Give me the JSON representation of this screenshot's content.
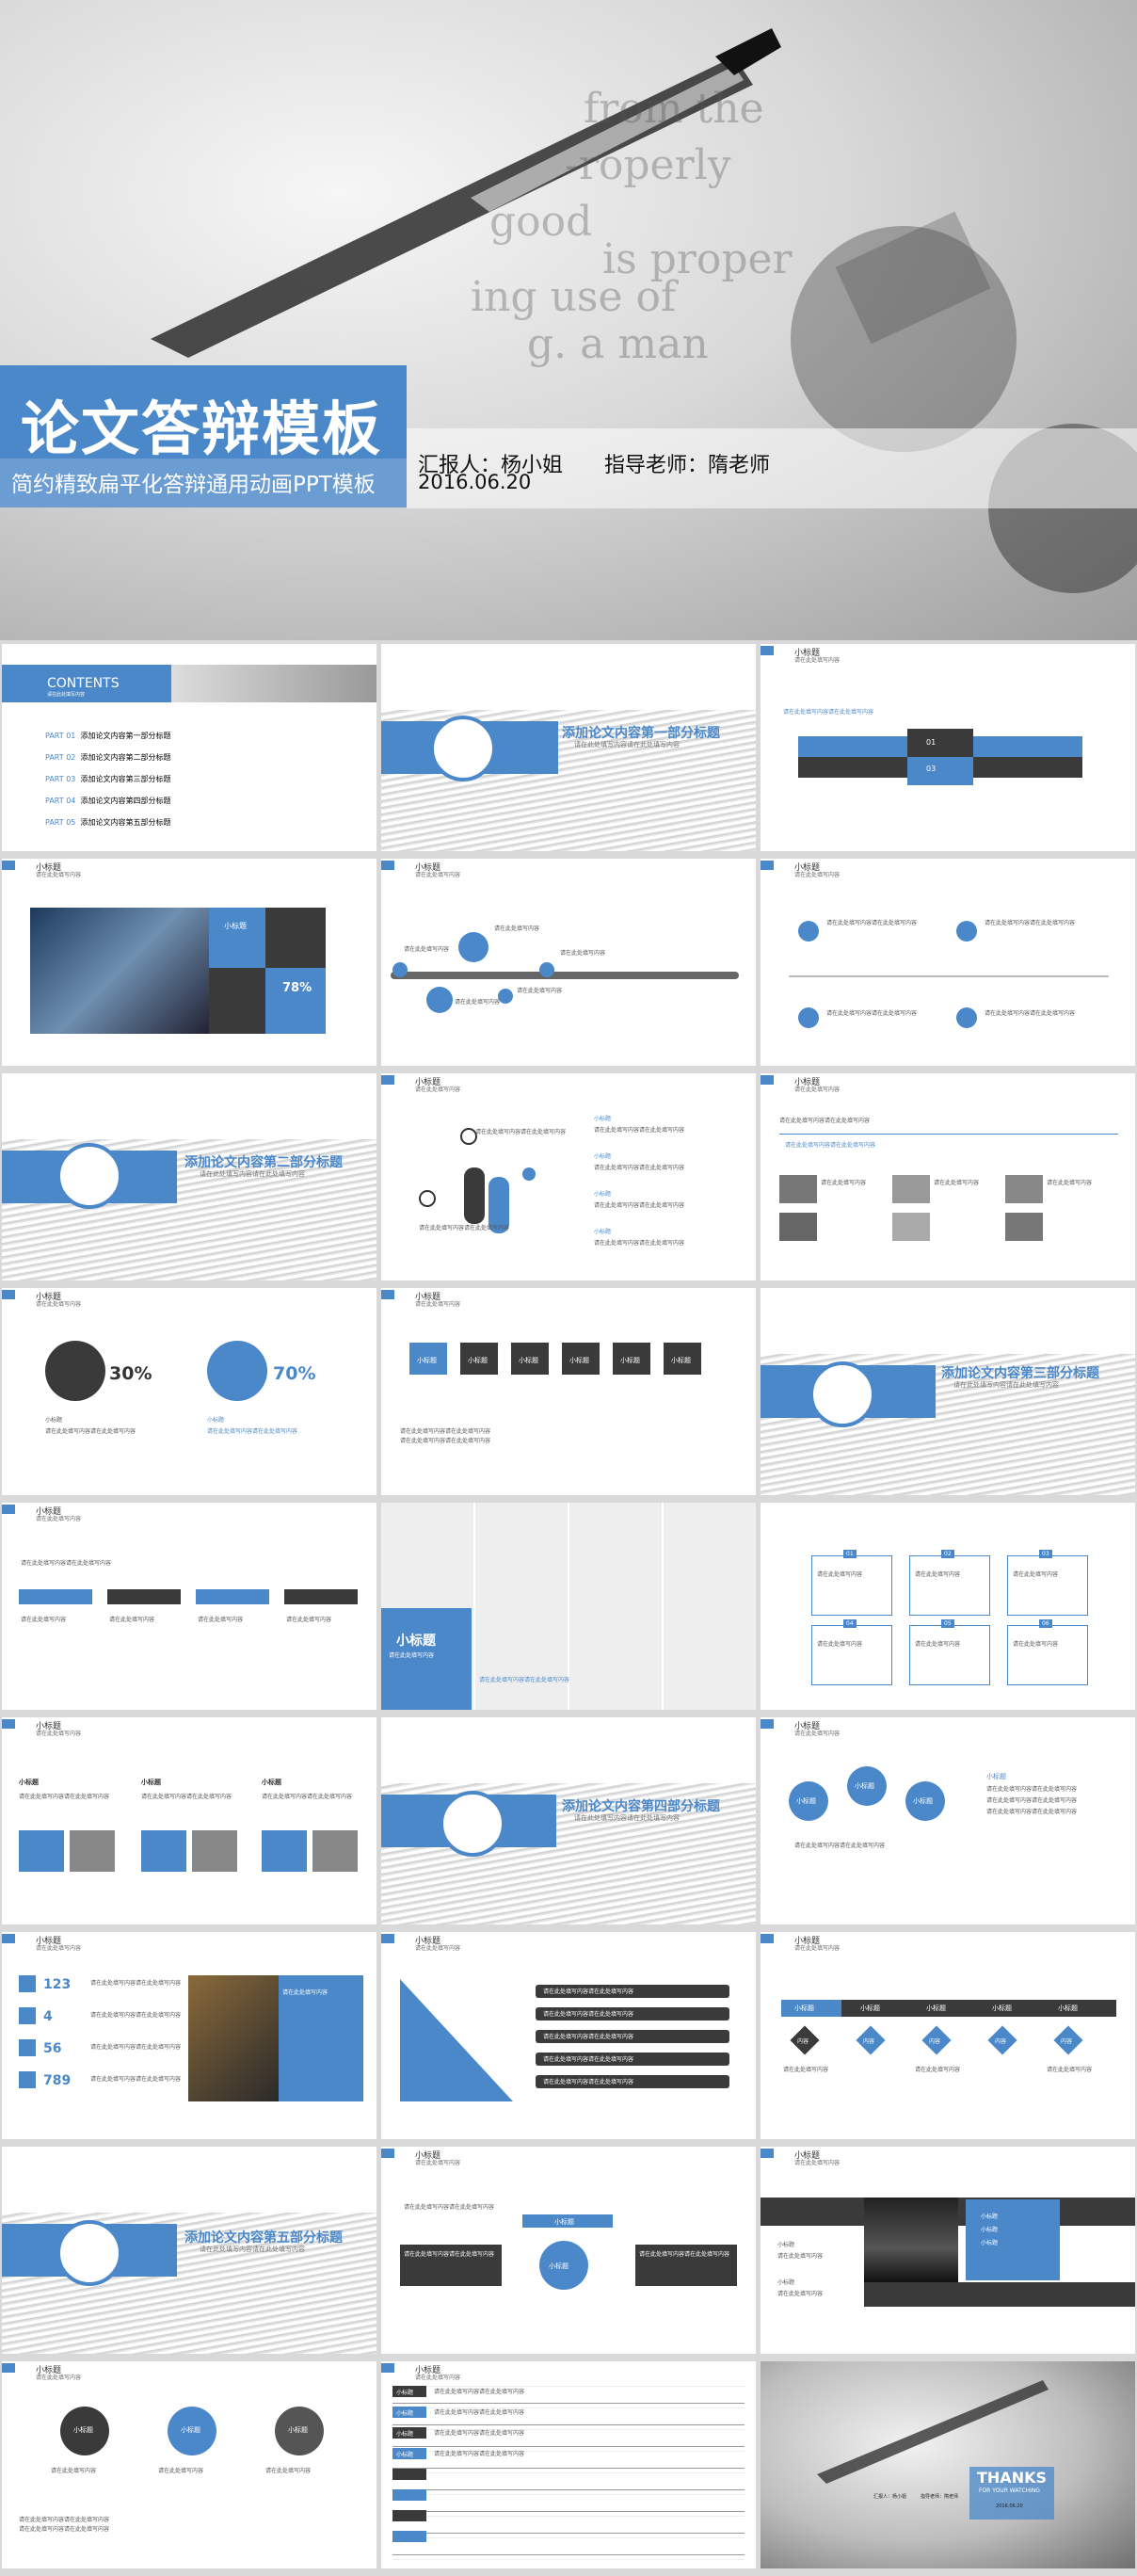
{
  "cover": {
    "title": "论文答辩模板",
    "subtitle": "简约精致扁平化答辩通用动画PPT模板",
    "reporter": "汇报人：杨小姐",
    "advisor": "指导老师：隋老师",
    "date": "2016.06.20"
  },
  "contents": {
    "heading": "CONTENTS",
    "items": [
      {
        "num": "PART 01",
        "label": "添加论文内容第一部分标题"
      },
      {
        "num": "PART 02",
        "label": "添加论文内容第二部分标题"
      },
      {
        "num": "PART 03",
        "label": "添加论文内容第三部分标题"
      },
      {
        "num": "PART 04",
        "label": "添加论文内容第四部分标题"
      },
      {
        "num": "PART 05",
        "label": "添加论文内容第五部分标题"
      }
    ]
  },
  "common": {
    "small_title": "小标题",
    "sample": "请在此处填写内容请在此处填写内容",
    "sample_short": "请在此处填写内容"
  },
  "sections": {
    "s1": "添加论文内容第一部分标题",
    "s2": "添加论文内容第二部分标题",
    "s3": "添加论文内容第三部分标题",
    "s4": "添加论文内容第四部分标题",
    "s5": "添加论文内容第五部分标题"
  },
  "stats": {
    "pct78": "78%",
    "male_pct": "30%",
    "female_pct": "70%",
    "n123": "123",
    "n4": "4",
    "n56": "56",
    "n789": "789"
  },
  "boxed": {
    "b01": "01",
    "b02": "02",
    "b03": "03",
    "b04": "04",
    "b05": "05",
    "b06": "06"
  },
  "flow_content": "内容",
  "thanks": {
    "title": "THANKS",
    "sub": "FOR YOUR WATCHING",
    "reporter": "汇报人：杨小姐",
    "advisor": "指导老师：隋老师",
    "date": "2016.06.20"
  }
}
